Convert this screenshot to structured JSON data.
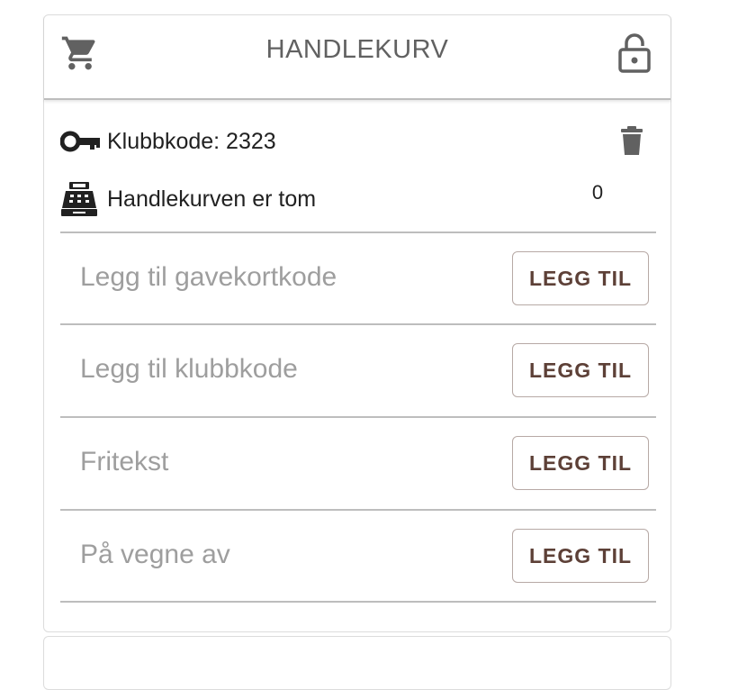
{
  "header": {
    "title": "HANDLEKURV",
    "cart_icon": "shopping-cart-icon",
    "lock_icon": "lock-open-icon"
  },
  "club": {
    "label": "Klubbkode: 2323",
    "icon": "key-icon",
    "delete_icon": "trash-icon"
  },
  "cart_status": {
    "label": "Handlekurven er tom",
    "count": "0",
    "icon": "cash-register-icon"
  },
  "entries": [
    {
      "placeholder": "Legg til gavekortkode",
      "button_label": "LEGG TIL"
    },
    {
      "placeholder": "Legg til klubbkode",
      "button_label": "LEGG TIL"
    },
    {
      "placeholder": "Fritekst",
      "button_label": "LEGG TIL"
    },
    {
      "placeholder": "På vegne av",
      "button_label": "LEGG TIL"
    }
  ],
  "colors": {
    "icon": "#616161",
    "button_text": "#5d4037",
    "button_border": "#b7a9a5",
    "placeholder": "#9e9e9e",
    "divider": "#bdbdbd"
  }
}
